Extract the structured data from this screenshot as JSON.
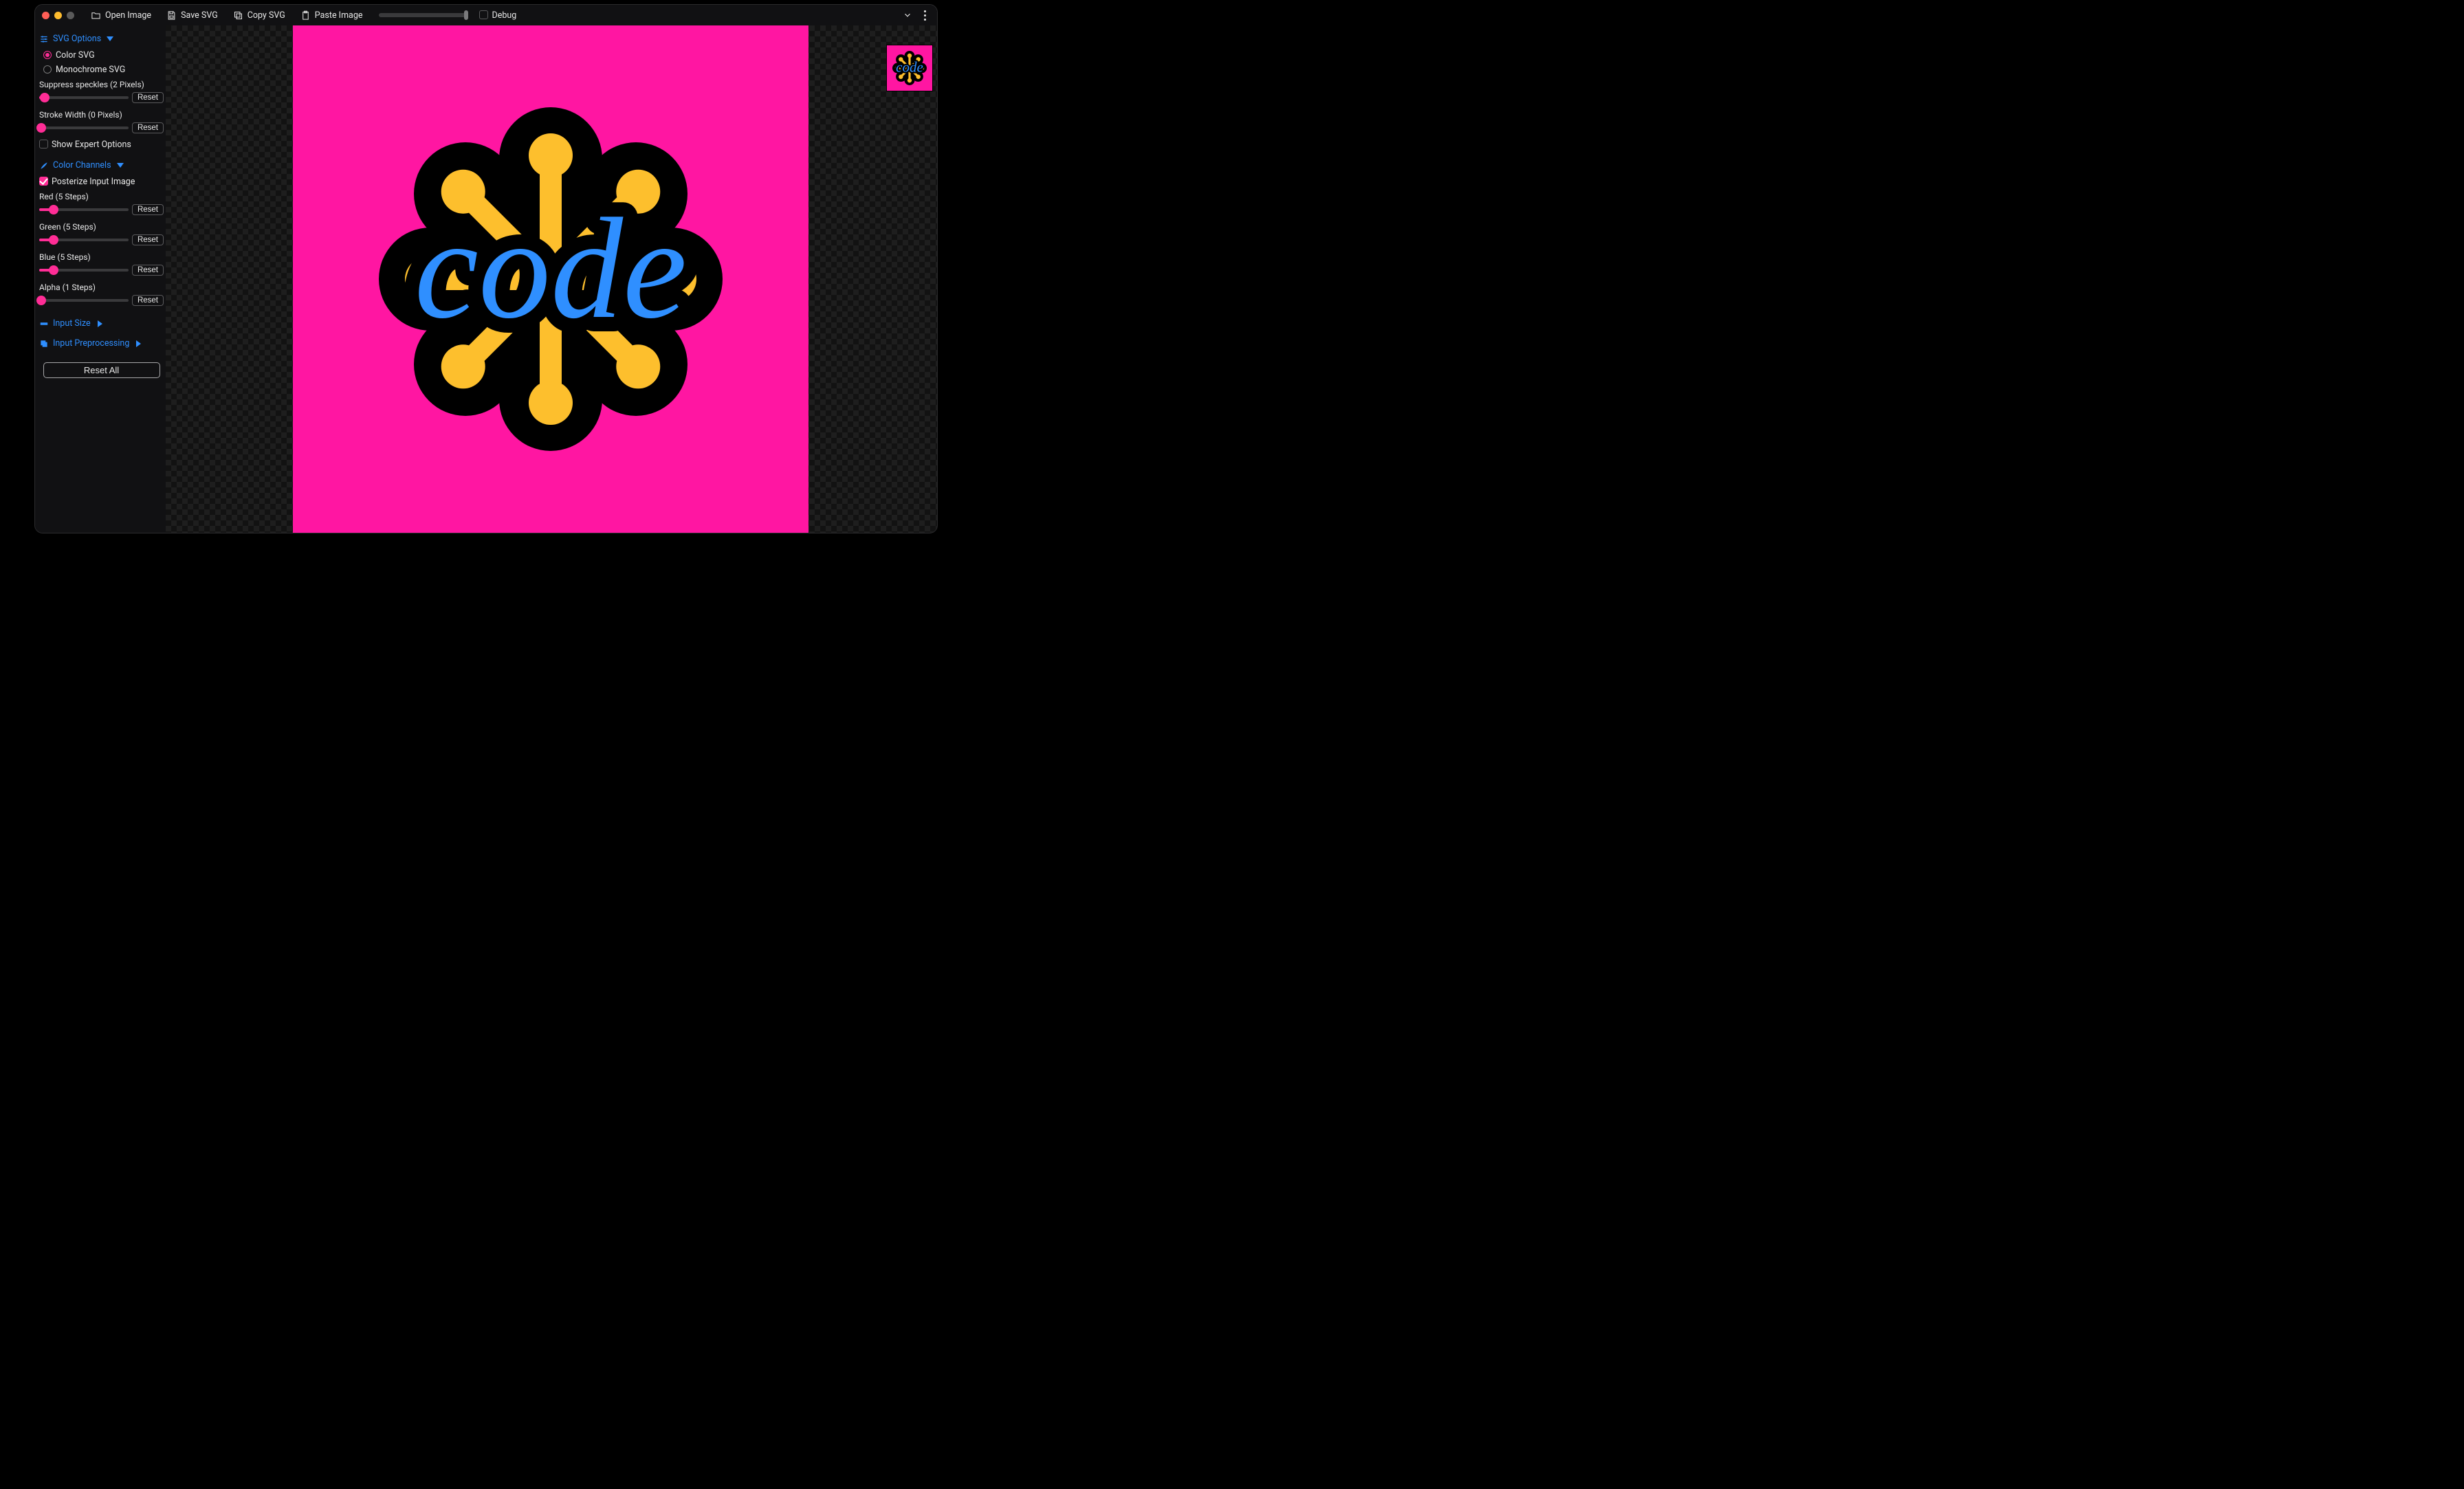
{
  "toolbar": {
    "open_image": "Open Image",
    "save_svg": "Save SVG",
    "copy_svg": "Copy SVG",
    "paste_image": "Paste Image",
    "debug_label": "Debug",
    "debug_checked": false
  },
  "sections": {
    "svg_options": {
      "title": "SVG Options",
      "color_svg": "Color SVG",
      "mono_svg": "Monochrome SVG",
      "suppress_label": "Suppress speckles (2 Pixels)",
      "suppress_pct": 6,
      "stroke_label": "Stroke Width (0 Pixels)",
      "stroke_pct": 2,
      "show_expert": "Show Expert Options",
      "reset": "Reset"
    },
    "color_channels": {
      "title": "Color Channels",
      "posterize_label": "Posterize Input Image",
      "posterize_checked": true,
      "red_label": "Red (5 Steps)",
      "red_pct": 16,
      "green_label": "Green (5 Steps)",
      "green_pct": 16,
      "blue_label": "Blue (5 Steps)",
      "blue_pct": 16,
      "alpha_label": "Alpha (1 Steps)",
      "alpha_pct": 2,
      "reset": "Reset"
    },
    "input_size": {
      "title": "Input Size"
    },
    "input_preprocessing": {
      "title": "Input Preprocessing"
    },
    "reset_all": "Reset All"
  },
  "artwork": {
    "bg": "#ff16a2",
    "word": "code",
    "colors": {
      "outline": "#000000",
      "burst": "#fdbf2d",
      "text": "#2f8fff"
    }
  }
}
